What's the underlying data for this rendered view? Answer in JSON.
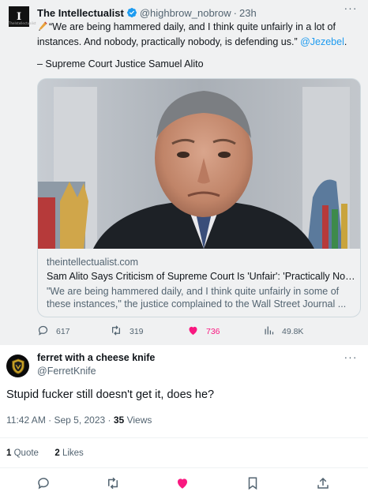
{
  "quoted": {
    "author_name": "The Intellectualist",
    "handle": "@highbrow_nobrow",
    "separator": "·",
    "time": "23h",
    "avatar_text": "I",
    "avatar_subtext": "TheIntellectualist",
    "text_line": "“We are being hammered daily, and I think quite unfairly in a lot of instances. And nobody, practically nobody, is defending us.”",
    "mention": "@Jezebel",
    "text_end": ".",
    "signature": "– Supreme Court Justice Samuel Alito",
    "card": {
      "domain": "theintellectualist.com",
      "title": "Sam Alito Says Criticism of Supreme Court Is 'Unfair': 'Practically Nobody Is Defending Us'",
      "description": "\"We are being hammered daily, and I think quite unfairly in some of these instances,\" the justice complained to the Wall Street Journal ..."
    },
    "actions": {
      "replies": "617",
      "reposts": "319",
      "likes": "736",
      "views": "49.8K"
    }
  },
  "reply": {
    "author_name": "ferret with a cheese knife",
    "handle": "@FerretKnife",
    "text": "Stupid fucker still doesn't get it, does he?",
    "time": "11:42 AM · Sep 5, 2023 · ",
    "views_count": "35",
    "views_label": " Views",
    "quote_count": "1",
    "quote_label": " Quote",
    "like_count": "2",
    "like_label": " Likes"
  },
  "colors": {
    "accent": "#1d9bf0",
    "like": "#f91880",
    "secondary_text": "#536471",
    "quoted_background": "#f0f1f2"
  },
  "icons": [
    "verified-icon",
    "pencil-icon",
    "more-icon",
    "reply-icon",
    "repost-icon",
    "heart-icon",
    "views-icon",
    "bookmark-icon",
    "share-icon"
  ]
}
